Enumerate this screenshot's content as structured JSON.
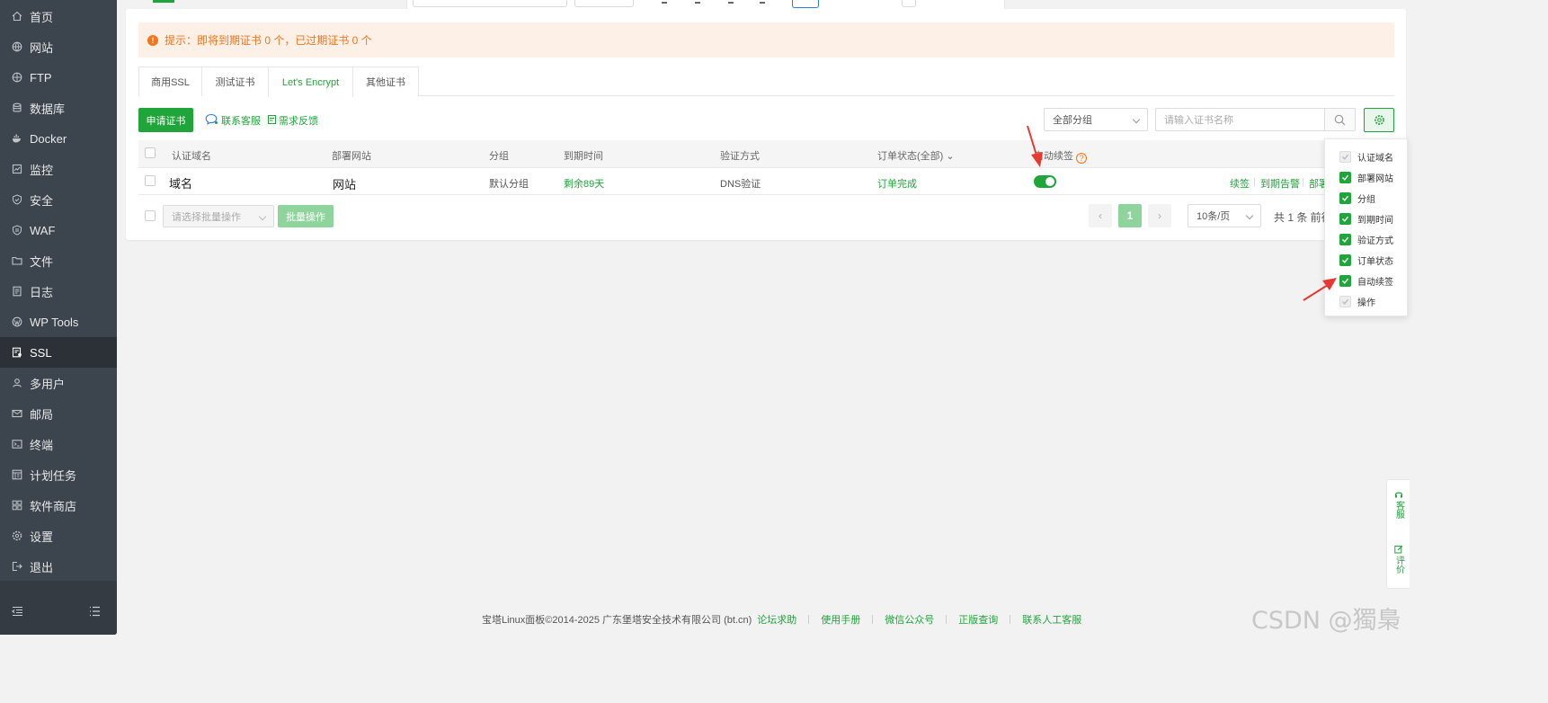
{
  "sidebar": {
    "items": [
      {
        "label": "首页",
        "icon": "home-icon"
      },
      {
        "label": "网站",
        "icon": "globe-icon"
      },
      {
        "label": "FTP",
        "icon": "ftp-icon"
      },
      {
        "label": "数据库",
        "icon": "database-icon"
      },
      {
        "label": "Docker",
        "icon": "docker-icon"
      },
      {
        "label": "监控",
        "icon": "monitor-icon"
      },
      {
        "label": "安全",
        "icon": "shield-icon"
      },
      {
        "label": "WAF",
        "icon": "waf-shield-icon"
      },
      {
        "label": "文件",
        "icon": "folder-icon"
      },
      {
        "label": "日志",
        "icon": "log-icon"
      },
      {
        "label": "WP Tools",
        "icon": "wordpress-icon"
      },
      {
        "label": "SSL",
        "icon": "ssl-certificate-icon",
        "active": true
      },
      {
        "label": "多用户",
        "icon": "users-icon"
      },
      {
        "label": "邮局",
        "icon": "mail-icon"
      },
      {
        "label": "终端",
        "icon": "terminal-icon"
      },
      {
        "label": "计划任务",
        "icon": "schedule-icon"
      },
      {
        "label": "软件商店",
        "icon": "store-icon"
      },
      {
        "label": "设置",
        "icon": "gear-icon"
      },
      {
        "label": "退出",
        "icon": "logout-icon"
      }
    ]
  },
  "alert": {
    "text": "提示：即将到期证书 0 个，已过期证书 0 个"
  },
  "tabs": [
    {
      "label": "商用SSL"
    },
    {
      "label": "测试证书"
    },
    {
      "label": "Let's Encrypt",
      "active": true
    },
    {
      "label": "其他证书"
    }
  ],
  "toolbar": {
    "apply_label": "申请证书",
    "contact_label": "联系客服",
    "feedback_label": "需求反馈",
    "group_select": "全部分组",
    "search_placeholder": "请输入证书名称"
  },
  "table": {
    "headers": {
      "domain": "认证域名",
      "site": "部署网站",
      "group": "分组",
      "expire": "到期时间",
      "verify": "验证方式",
      "order": "订单状态(全部)",
      "autorenew": "自动续签"
    },
    "rows": [
      {
        "domain": "域名",
        "site": "网站",
        "group": "默认分组",
        "expire": "剩余89天",
        "verify": "DNS验证",
        "order": "订单完成",
        "autorenew": true,
        "ops": [
          "续签",
          "到期告警",
          "部署"
        ]
      }
    ]
  },
  "batch": {
    "select_placeholder": "请选择批量操作",
    "button_label": "批量操作"
  },
  "pagination": {
    "current": "1",
    "page_size": "10条/页",
    "total_text": "共 1 条  前往"
  },
  "column_menu": [
    {
      "label": "认证域名",
      "checked": true,
      "disabled": true
    },
    {
      "label": "部署网站",
      "checked": true
    },
    {
      "label": "分组",
      "checked": true
    },
    {
      "label": "到期时间",
      "checked": true
    },
    {
      "label": "验证方式",
      "checked": true
    },
    {
      "label": "订单状态",
      "checked": true
    },
    {
      "label": "自动续签",
      "checked": true
    },
    {
      "label": "操作",
      "checked": true,
      "disabled": true
    }
  ],
  "float_panel": {
    "support": "客服",
    "review": "评价"
  },
  "footer": {
    "copyright": "宝塔Linux面板©2014-2025 广东堡塔安全技术有限公司 (bt.cn)",
    "links": [
      "论坛求助",
      "使用手册",
      "微信公众号",
      "正版查询",
      "联系人工客服"
    ]
  },
  "watermark": "CSDN @獨梟",
  "colors": {
    "accent": "#20a53a",
    "warning": "#f7741a",
    "sidebar": "#3c444d",
    "arrow": "#e8382f"
  }
}
